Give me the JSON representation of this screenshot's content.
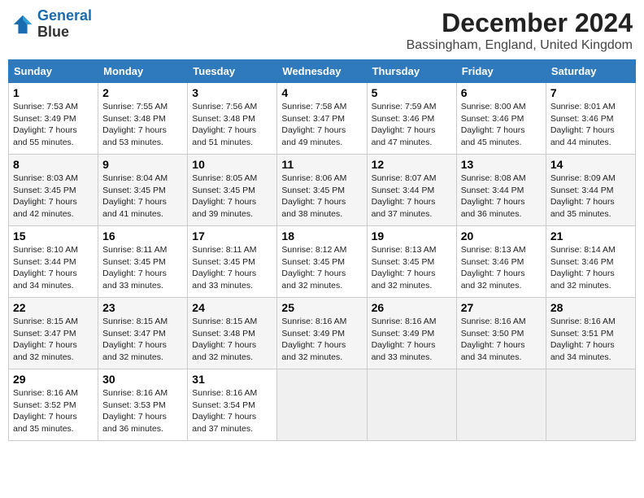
{
  "header": {
    "logo_line1": "General",
    "logo_line2": "Blue",
    "month_title": "December 2024",
    "location": "Bassingham, England, United Kingdom"
  },
  "weekdays": [
    "Sunday",
    "Monday",
    "Tuesday",
    "Wednesday",
    "Thursday",
    "Friday",
    "Saturday"
  ],
  "weeks": [
    [
      {
        "day": "1",
        "sunrise": "7:53 AM",
        "sunset": "3:49 PM",
        "daylight": "7 hours and 55 minutes."
      },
      {
        "day": "2",
        "sunrise": "7:55 AM",
        "sunset": "3:48 PM",
        "daylight": "7 hours and 53 minutes."
      },
      {
        "day": "3",
        "sunrise": "7:56 AM",
        "sunset": "3:48 PM",
        "daylight": "7 hours and 51 minutes."
      },
      {
        "day": "4",
        "sunrise": "7:58 AM",
        "sunset": "3:47 PM",
        "daylight": "7 hours and 49 minutes."
      },
      {
        "day": "5",
        "sunrise": "7:59 AM",
        "sunset": "3:46 PM",
        "daylight": "7 hours and 47 minutes."
      },
      {
        "day": "6",
        "sunrise": "8:00 AM",
        "sunset": "3:46 PM",
        "daylight": "7 hours and 45 minutes."
      },
      {
        "day": "7",
        "sunrise": "8:01 AM",
        "sunset": "3:46 PM",
        "daylight": "7 hours and 44 minutes."
      }
    ],
    [
      {
        "day": "8",
        "sunrise": "8:03 AM",
        "sunset": "3:45 PM",
        "daylight": "7 hours and 42 minutes."
      },
      {
        "day": "9",
        "sunrise": "8:04 AM",
        "sunset": "3:45 PM",
        "daylight": "7 hours and 41 minutes."
      },
      {
        "day": "10",
        "sunrise": "8:05 AM",
        "sunset": "3:45 PM",
        "daylight": "7 hours and 39 minutes."
      },
      {
        "day": "11",
        "sunrise": "8:06 AM",
        "sunset": "3:45 PM",
        "daylight": "7 hours and 38 minutes."
      },
      {
        "day": "12",
        "sunrise": "8:07 AM",
        "sunset": "3:44 PM",
        "daylight": "7 hours and 37 minutes."
      },
      {
        "day": "13",
        "sunrise": "8:08 AM",
        "sunset": "3:44 PM",
        "daylight": "7 hours and 36 minutes."
      },
      {
        "day": "14",
        "sunrise": "8:09 AM",
        "sunset": "3:44 PM",
        "daylight": "7 hours and 35 minutes."
      }
    ],
    [
      {
        "day": "15",
        "sunrise": "8:10 AM",
        "sunset": "3:44 PM",
        "daylight": "7 hours and 34 minutes."
      },
      {
        "day": "16",
        "sunrise": "8:11 AM",
        "sunset": "3:45 PM",
        "daylight": "7 hours and 33 minutes."
      },
      {
        "day": "17",
        "sunrise": "8:11 AM",
        "sunset": "3:45 PM",
        "daylight": "7 hours and 33 minutes."
      },
      {
        "day": "18",
        "sunrise": "8:12 AM",
        "sunset": "3:45 PM",
        "daylight": "7 hours and 32 minutes."
      },
      {
        "day": "19",
        "sunrise": "8:13 AM",
        "sunset": "3:45 PM",
        "daylight": "7 hours and 32 minutes."
      },
      {
        "day": "20",
        "sunrise": "8:13 AM",
        "sunset": "3:46 PM",
        "daylight": "7 hours and 32 minutes."
      },
      {
        "day": "21",
        "sunrise": "8:14 AM",
        "sunset": "3:46 PM",
        "daylight": "7 hours and 32 minutes."
      }
    ],
    [
      {
        "day": "22",
        "sunrise": "8:15 AM",
        "sunset": "3:47 PM",
        "daylight": "7 hours and 32 minutes."
      },
      {
        "day": "23",
        "sunrise": "8:15 AM",
        "sunset": "3:47 PM",
        "daylight": "7 hours and 32 minutes."
      },
      {
        "day": "24",
        "sunrise": "8:15 AM",
        "sunset": "3:48 PM",
        "daylight": "7 hours and 32 minutes."
      },
      {
        "day": "25",
        "sunrise": "8:16 AM",
        "sunset": "3:49 PM",
        "daylight": "7 hours and 32 minutes."
      },
      {
        "day": "26",
        "sunrise": "8:16 AM",
        "sunset": "3:49 PM",
        "daylight": "7 hours and 33 minutes."
      },
      {
        "day": "27",
        "sunrise": "8:16 AM",
        "sunset": "3:50 PM",
        "daylight": "7 hours and 34 minutes."
      },
      {
        "day": "28",
        "sunrise": "8:16 AM",
        "sunset": "3:51 PM",
        "daylight": "7 hours and 34 minutes."
      }
    ],
    [
      {
        "day": "29",
        "sunrise": "8:16 AM",
        "sunset": "3:52 PM",
        "daylight": "7 hours and 35 minutes."
      },
      {
        "day": "30",
        "sunrise": "8:16 AM",
        "sunset": "3:53 PM",
        "daylight": "7 hours and 36 minutes."
      },
      {
        "day": "31",
        "sunrise": "8:16 AM",
        "sunset": "3:54 PM",
        "daylight": "7 hours and 37 minutes."
      },
      null,
      null,
      null,
      null
    ]
  ]
}
